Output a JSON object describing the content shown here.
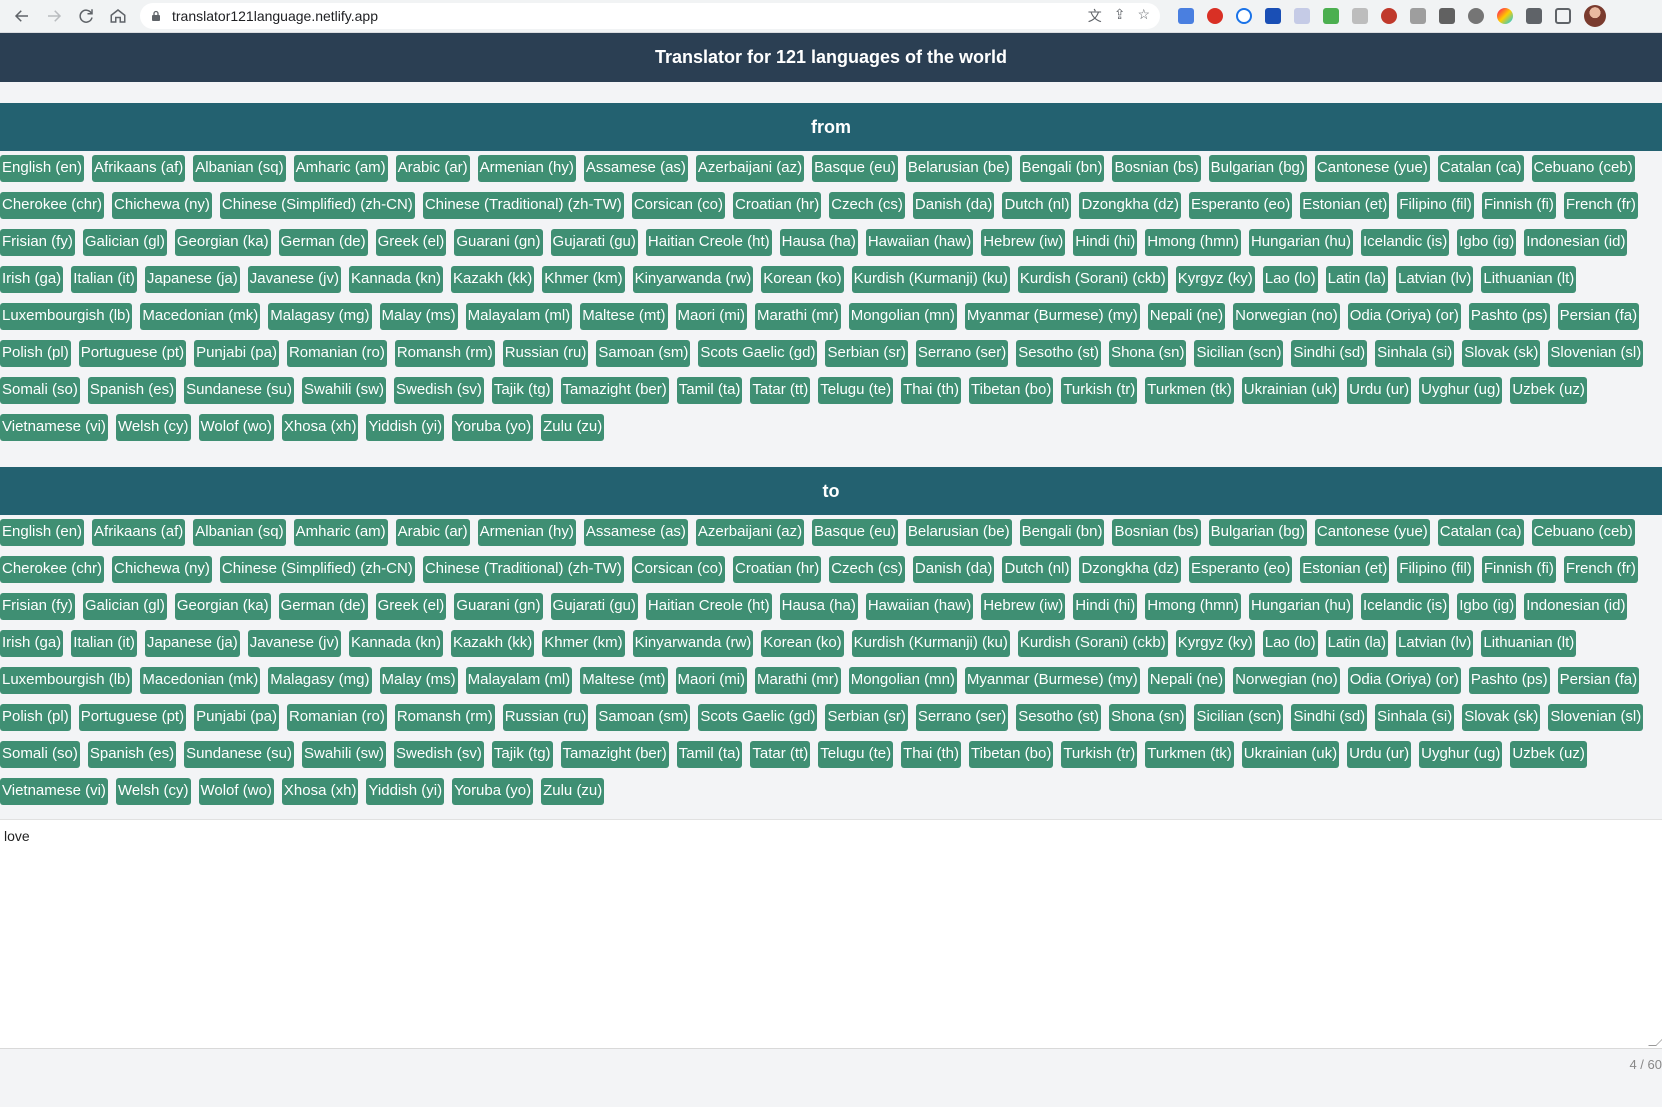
{
  "browser": {
    "url": "translator121language.netlify.app"
  },
  "app": {
    "title": "Translator for 121 languages of the world"
  },
  "from_section": {
    "title": "from"
  },
  "to_section": {
    "title": "to"
  },
  "languages": [
    "English (en)",
    "Afrikaans (af)",
    "Albanian (sq)",
    "Amharic (am)",
    "Arabic (ar)",
    "Armenian (hy)",
    "Assamese (as)",
    "Azerbaijani (az)",
    "Basque (eu)",
    "Belarusian (be)",
    "Bengali (bn)",
    "Bosnian (bs)",
    "Bulgarian (bg)",
    "Cantonese (yue)",
    "Catalan (ca)",
    "Cebuano (ceb)",
    "Cherokee (chr)",
    "Chichewa (ny)",
    "Chinese (Simplified) (zh-CN)",
    "Chinese (Traditional) (zh-TW)",
    "Corsican (co)",
    "Croatian (hr)",
    "Czech (cs)",
    "Danish (da)",
    "Dutch (nl)",
    "Dzongkha (dz)",
    "Esperanto (eo)",
    "Estonian (et)",
    "Filipino (fil)",
    "Finnish (fi)",
    "French (fr)",
    "Frisian (fy)",
    "Galician (gl)",
    "Georgian (ka)",
    "German (de)",
    "Greek (el)",
    "Guarani (gn)",
    "Gujarati (gu)",
    "Haitian Creole (ht)",
    "Hausa (ha)",
    "Hawaiian (haw)",
    "Hebrew (iw)",
    "Hindi (hi)",
    "Hmong (hmn)",
    "Hungarian (hu)",
    "Icelandic (is)",
    "Igbo (ig)",
    "Indonesian (id)",
    "Irish (ga)",
    "Italian (it)",
    "Japanese (ja)",
    "Javanese (jv)",
    "Kannada (kn)",
    "Kazakh (kk)",
    "Khmer (km)",
    "Kinyarwanda (rw)",
    "Korean (ko)",
    "Kurdish (Kurmanji) (ku)",
    "Kurdish (Sorani) (ckb)",
    "Kyrgyz (ky)",
    "Lao (lo)",
    "Latin (la)",
    "Latvian (lv)",
    "Lithuanian (lt)",
    "Luxembourgish (lb)",
    "Macedonian (mk)",
    "Malagasy (mg)",
    "Malay (ms)",
    "Malayalam (ml)",
    "Maltese (mt)",
    "Maori (mi)",
    "Marathi (mr)",
    "Mongolian (mn)",
    "Myanmar (Burmese) (my)",
    "Nepali (ne)",
    "Norwegian (no)",
    "Odia (Oriya) (or)",
    "Pashto (ps)",
    "Persian (fa)",
    "Polish (pl)",
    "Portuguese (pt)",
    "Punjabi (pa)",
    "Romanian (ro)",
    "Romansh (rm)",
    "Russian (ru)",
    "Samoan (sm)",
    "Scots Gaelic (gd)",
    "Serbian (sr)",
    "Serrano (ser)",
    "Sesotho (st)",
    "Shona (sn)",
    "Sicilian (scn)",
    "Sindhi (sd)",
    "Sinhala (si)",
    "Slovak (sk)",
    "Slovenian (sl)",
    "Somali (so)",
    "Spanish (es)",
    "Sundanese (su)",
    "Swahili (sw)",
    "Swedish (sv)",
    "Tajik (tg)",
    "Tamazight (ber)",
    "Tamil (ta)",
    "Tatar (tt)",
    "Telugu (te)",
    "Thai (th)",
    "Tibetan (bo)",
    "Turkish (tr)",
    "Turkmen (tk)",
    "Ukrainian (uk)",
    "Urdu (ur)",
    "Uyghur (ug)",
    "Uzbek (uz)",
    "Vietnamese (vi)",
    "Welsh (cy)",
    "Wolof (wo)",
    "Xhosa (xh)",
    "Yiddish (yi)",
    "Yoruba (yo)",
    "Zulu (zu)"
  ],
  "input": {
    "value": "love"
  },
  "char_counter": "4 / 60",
  "colors": {
    "header_bg": "#2b3f53",
    "section_bg": "#236170",
    "chip_bg": "#3f8f73"
  }
}
